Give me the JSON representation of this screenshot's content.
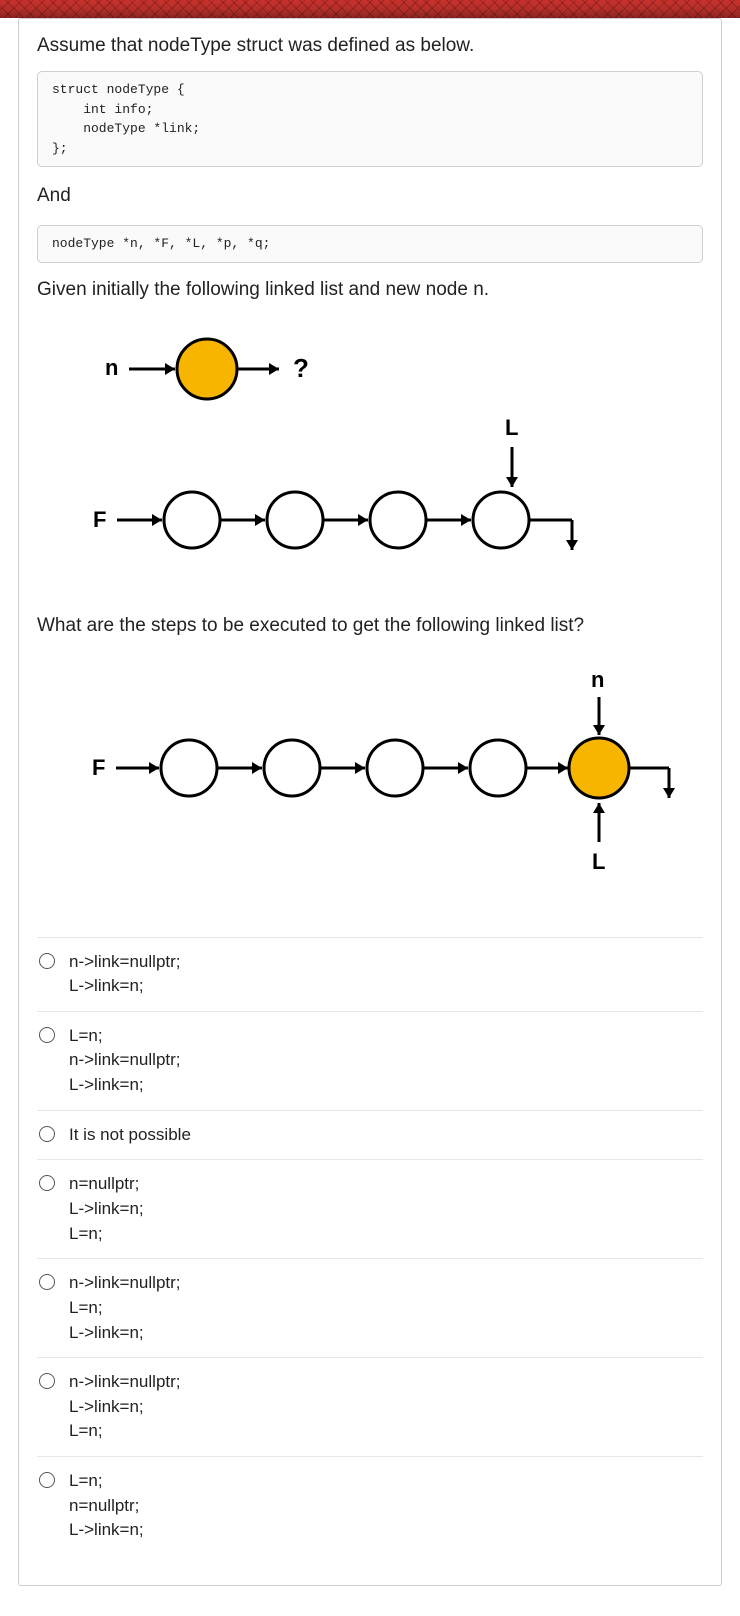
{
  "intro": "Assume that nodeType struct was defined as below.",
  "code1": "struct nodeType {\n    int info;\n    nodeType *link;\n};",
  "and_label": "And",
  "code2": "nodeType *n, *F, *L, *p, *q;",
  "given": "Given initially the following linked list and new node n.",
  "question": "What are the steps to be executed to get the following linked list?",
  "diagram1": {
    "n_label": "n",
    "qmark": "?",
    "F_label": "F",
    "L_label": "L"
  },
  "diagram2": {
    "F_label": "F",
    "n_label": "n",
    "L_label": "L"
  },
  "options": [
    "n->link=nullptr;\nL->link=n;",
    "L=n;\nn->link=nullptr;\nL->link=n;",
    "It is not possible",
    "n=nullptr;\nL->link=n;\nL=n;",
    "n->link=nullptr;\nL=n;\nL->link=n;",
    "n->link=nullptr;\nL->link=n;\nL=n;",
    "L=n;\nn=nullptr;\nL->link=n;"
  ]
}
